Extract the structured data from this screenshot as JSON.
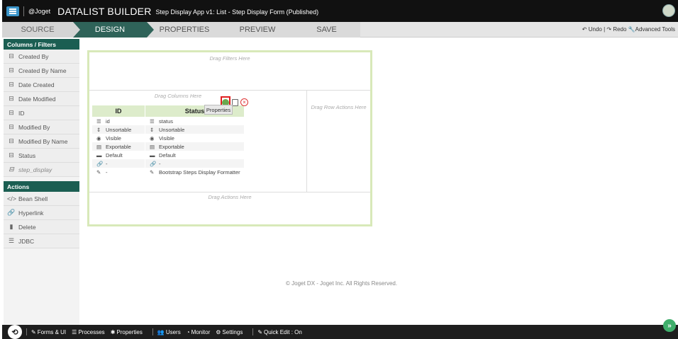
{
  "topbar": {
    "logo": "@Joget",
    "title": "DATALIST BUILDER",
    "subtitle": "Step Display App v1: List - Step Display Form (Published)"
  },
  "tabs": {
    "source": "SOURCE",
    "design": "DESIGN",
    "properties": "PROPERTIES",
    "preview": "PREVIEW",
    "save": "SAVE",
    "undo": "Undo",
    "redo": "Redo",
    "advanced": "Advanced Tools"
  },
  "sidebar": {
    "columns_header": "Columns / Filters",
    "columns": [
      "Created By",
      "Created By Name",
      "Date Created",
      "Date Modified",
      "ID",
      "Modified By",
      "Modified By Name",
      "Status",
      "step_display"
    ],
    "actions_header": "Actions",
    "actions": [
      "Bean Shell",
      "Hyperlink",
      "Delete",
      "JDBC"
    ]
  },
  "canvas": {
    "filters_drop": "Drag Filters Here",
    "columns_drop": "Drag Columns Here",
    "row_actions_drop": "Drag Row Actions Here",
    "actions_drop": "Drag Actions Here",
    "tooltip": "Properties",
    "id_column": {
      "header": "ID",
      "rows": [
        "id",
        "Unsortable",
        "Visible",
        "Exportable",
        "Default",
        "-",
        "-"
      ]
    },
    "status_column": {
      "header": "Status",
      "rows": [
        "status",
        "Unsortable",
        "Visible",
        "Exportable",
        "Default",
        "-",
        "Bootstrap Steps Display Formatter"
      ]
    }
  },
  "footer": {
    "copyright": "© Joget DX - Joget Inc. All Rights Reserved."
  },
  "bottombar": {
    "forms": "Forms & UI",
    "processes": "Processes",
    "properties": "Properties",
    "users": "Users",
    "monitor": "Monitor",
    "settings": "Settings",
    "quick_edit": "Quick Edit : On"
  }
}
